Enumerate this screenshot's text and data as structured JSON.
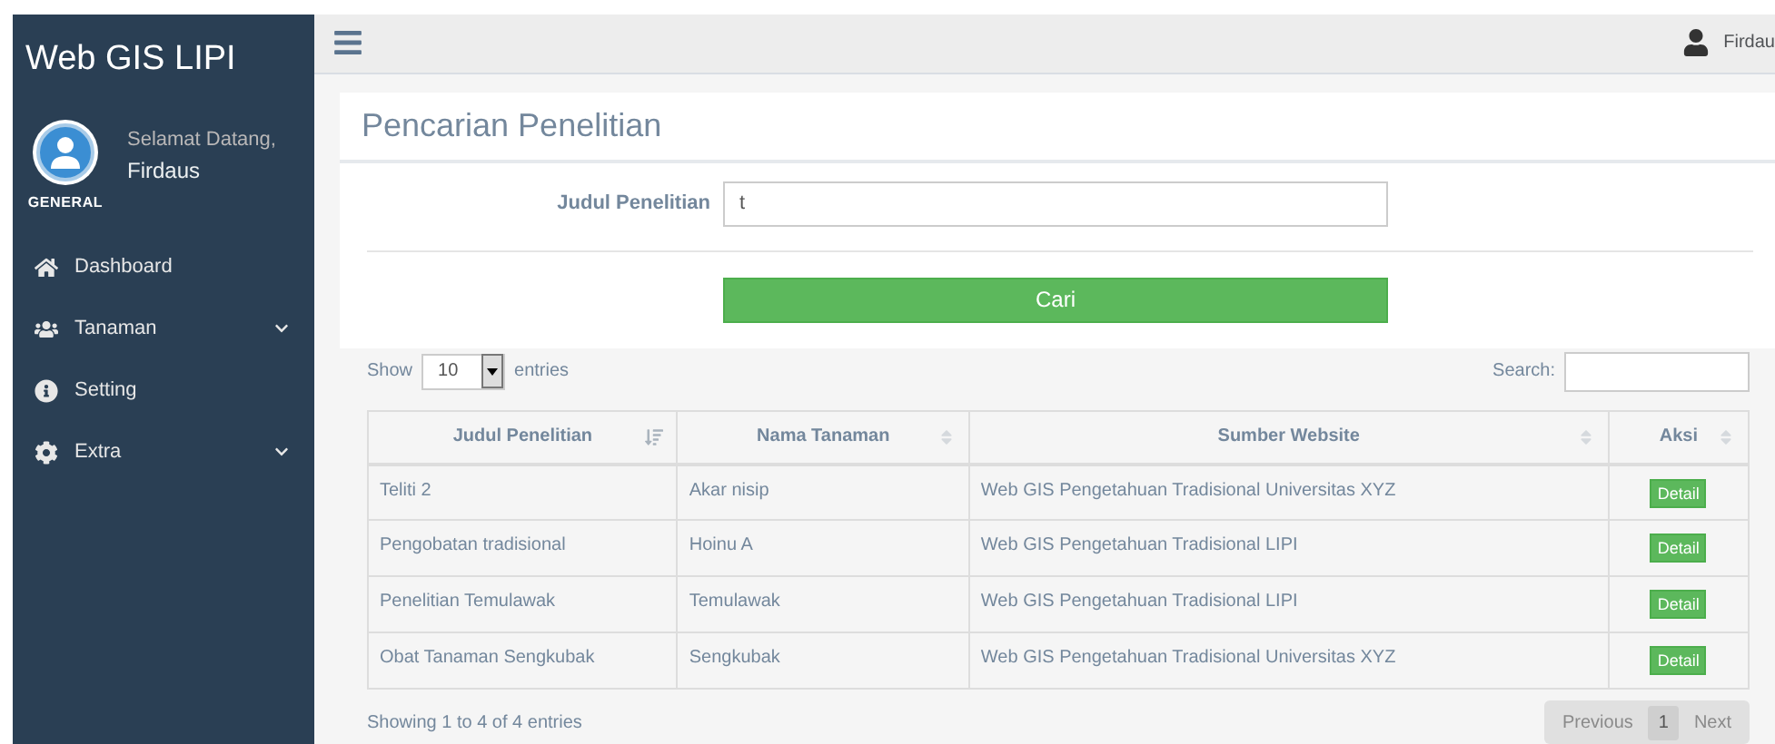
{
  "sidebar": {
    "brand": "Web GIS LIPI",
    "profile": {
      "greeting": "Selamat Datang,",
      "name": "Firdaus",
      "role": "GENERAL"
    },
    "items": [
      {
        "label": "Dashboard",
        "expandable": false
      },
      {
        "label": "Tanaman",
        "expandable": true
      },
      {
        "label": "Setting",
        "expandable": false
      },
      {
        "label": "Extra",
        "expandable": true
      }
    ]
  },
  "topbar": {
    "user": "Firdau"
  },
  "panel": {
    "title": "Pencarian Penelitian",
    "field_label": "Judul Penelitian",
    "field_value": "t",
    "button": "Cari"
  },
  "table_controls": {
    "show_label": "Show",
    "page_size": "10",
    "entries_label": "entries",
    "search_label": "Search:"
  },
  "table": {
    "columns": [
      {
        "label": "Judul Penelitian",
        "sorted": true
      },
      {
        "label": "Nama Tanaman",
        "sorted": false
      },
      {
        "label": "Sumber Website",
        "sorted": false
      },
      {
        "label": "Aksi",
        "sorted": false
      }
    ],
    "rows": [
      {
        "cells": [
          "Teliti 2",
          "Akar nisip",
          "Web GIS Pengetahuan Tradisional Universitas XYZ"
        ],
        "action": "Detail"
      },
      {
        "cells": [
          "Pengobatan tradisional",
          "Hoinu A",
          "Web GIS Pengetahuan Tradisional LIPI"
        ],
        "action": "Detail"
      },
      {
        "cells": [
          "Penelitian Temulawak",
          "Temulawak",
          "Web GIS Pengetahuan Tradisional LIPI"
        ],
        "action": "Detail"
      },
      {
        "cells": [
          "Obat Tanaman Sengkubak",
          "Sengkubak",
          "Web GIS Pengetahuan Tradisional Universitas XYZ"
        ],
        "action": "Detail"
      }
    ]
  },
  "footer": {
    "info": "Showing 1 to 4 of 4 entries",
    "pagination": [
      {
        "label": "Previous",
        "selected": false
      },
      {
        "label": "1",
        "selected": true
      },
      {
        "label": "Next",
        "selected": false
      }
    ]
  }
}
